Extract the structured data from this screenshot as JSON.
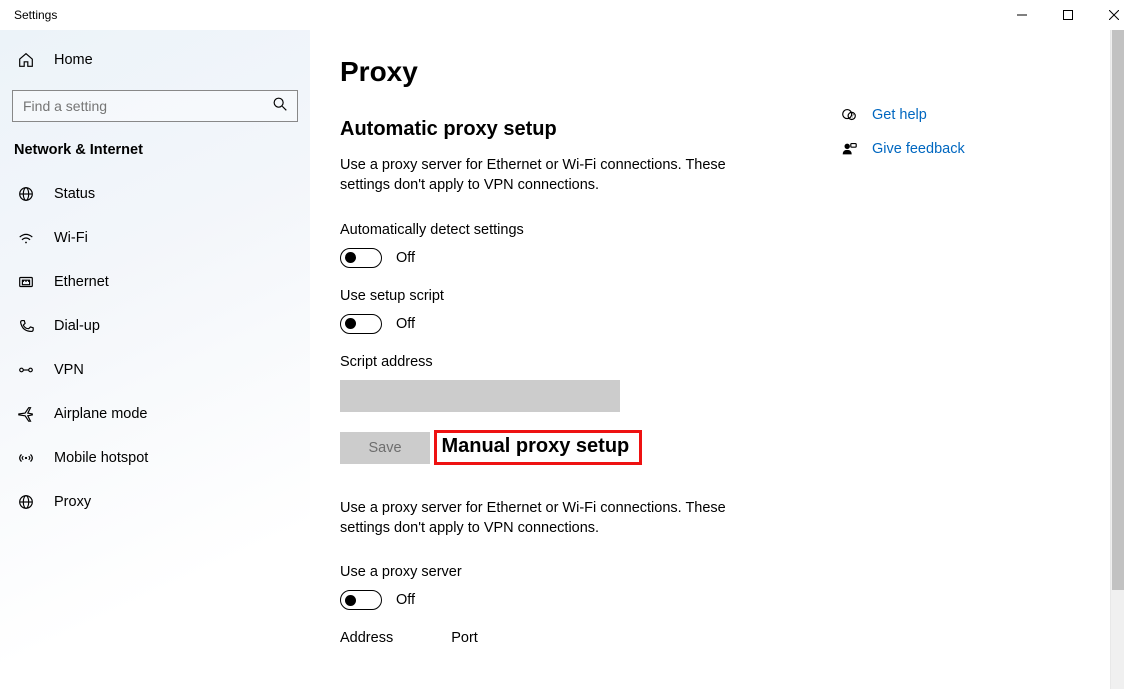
{
  "window": {
    "title": "Settings"
  },
  "sidebar": {
    "home": "Home",
    "search_placeholder": "Find a setting",
    "category": "Network & Internet",
    "items": [
      {
        "label": "Status"
      },
      {
        "label": "Wi-Fi"
      },
      {
        "label": "Ethernet"
      },
      {
        "label": "Dial-up"
      },
      {
        "label": "VPN"
      },
      {
        "label": "Airplane mode"
      },
      {
        "label": "Mobile hotspot"
      },
      {
        "label": "Proxy"
      }
    ]
  },
  "page": {
    "title": "Proxy",
    "auto": {
      "heading": "Automatic proxy setup",
      "desc": "Use a proxy server for Ethernet or Wi-Fi connections. These settings don't apply to VPN connections.",
      "detect_label": "Automatically detect settings",
      "detect_state": "Off",
      "script_toggle_label": "Use setup script",
      "script_toggle_state": "Off",
      "script_address_label": "Script address",
      "script_address_value": "",
      "save_label": "Save"
    },
    "manual": {
      "heading": "Manual proxy setup",
      "desc": "Use a proxy server for Ethernet or Wi-Fi connections. These settings don't apply to VPN connections.",
      "use_proxy_label": "Use a proxy server",
      "use_proxy_state": "Off",
      "address_label": "Address",
      "port_label": "Port"
    }
  },
  "side": {
    "help": "Get help",
    "feedback": "Give feedback"
  }
}
